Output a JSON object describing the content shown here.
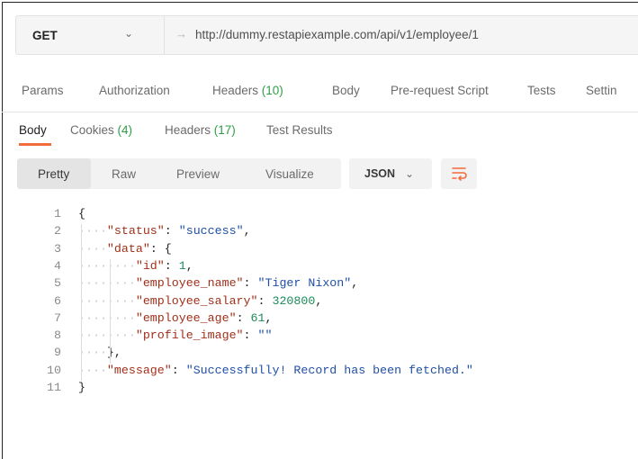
{
  "request": {
    "method": "GET",
    "url": "http://dummy.restapiexample.com/api/v1/employee/1"
  },
  "request_tabs": [
    {
      "label": "Params"
    },
    {
      "label": "Authorization"
    },
    {
      "label": "Headers",
      "count": "(10)"
    },
    {
      "label": "Body"
    },
    {
      "label": "Pre-request Script"
    },
    {
      "label": "Tests"
    },
    {
      "label": "Settin"
    }
  ],
  "response_tabs": [
    {
      "label": "Body",
      "count": ""
    },
    {
      "label": "Cookies",
      "count": "(4)"
    },
    {
      "label": "Headers",
      "count": "(17)"
    },
    {
      "label": "Test Results",
      "count": ""
    }
  ],
  "view_modes": [
    "Pretty",
    "Raw",
    "Preview",
    "Visualize"
  ],
  "format": "JSON",
  "icons": {
    "method_dropdown": "chevron-down-icon",
    "url_arrow": "arrow-right-icon",
    "wrap": "wrap-lines-icon"
  },
  "colors": {
    "accent": "#f26b3a",
    "count_green": "#2e9d47",
    "json_key": "#a0301a",
    "json_string": "#1f4fa6",
    "json_number": "#1e8a5b"
  },
  "code_lines": [
    {
      "no": "1",
      "dots": "",
      "parts": [
        [
          "p",
          "{"
        ]
      ]
    },
    {
      "no": "2",
      "dots": "····",
      "parts": [
        [
          "k",
          "\"status\""
        ],
        [
          "p",
          ": "
        ],
        [
          "s",
          "\"success\""
        ],
        [
          "p",
          ","
        ]
      ]
    },
    {
      "no": "3",
      "dots": "····",
      "parts": [
        [
          "k",
          "\"data\""
        ],
        [
          "p",
          ": {"
        ]
      ]
    },
    {
      "no": "4",
      "dots": "········",
      "parts": [
        [
          "k",
          "\"id\""
        ],
        [
          "p",
          ": "
        ],
        [
          "n",
          "1"
        ],
        [
          "p",
          ","
        ]
      ]
    },
    {
      "no": "5",
      "dots": "········",
      "parts": [
        [
          "k",
          "\"employee_name\""
        ],
        [
          "p",
          ": "
        ],
        [
          "s",
          "\"Tiger Nixon\""
        ],
        [
          "p",
          ","
        ]
      ]
    },
    {
      "no": "6",
      "dots": "········",
      "parts": [
        [
          "k",
          "\"employee_salary\""
        ],
        [
          "p",
          ": "
        ],
        [
          "n",
          "320800"
        ],
        [
          "p",
          ","
        ]
      ]
    },
    {
      "no": "7",
      "dots": "········",
      "parts": [
        [
          "k",
          "\"employee_age\""
        ],
        [
          "p",
          ": "
        ],
        [
          "n",
          "61"
        ],
        [
          "p",
          ","
        ]
      ]
    },
    {
      "no": "8",
      "dots": "········",
      "parts": [
        [
          "k",
          "\"profile_image\""
        ],
        [
          "p",
          ": "
        ],
        [
          "s",
          "\"\""
        ]
      ]
    },
    {
      "no": "9",
      "dots": "····",
      "parts": [
        [
          "p",
          "},"
        ]
      ]
    },
    {
      "no": "10",
      "dots": "····",
      "parts": [
        [
          "k",
          "\"message\""
        ],
        [
          "p",
          ": "
        ],
        [
          "s",
          "\"Successfully! Record has been fetched.\""
        ]
      ]
    },
    {
      "no": "11",
      "dots": "",
      "parts": [
        [
          "p",
          "}"
        ]
      ]
    }
  ]
}
